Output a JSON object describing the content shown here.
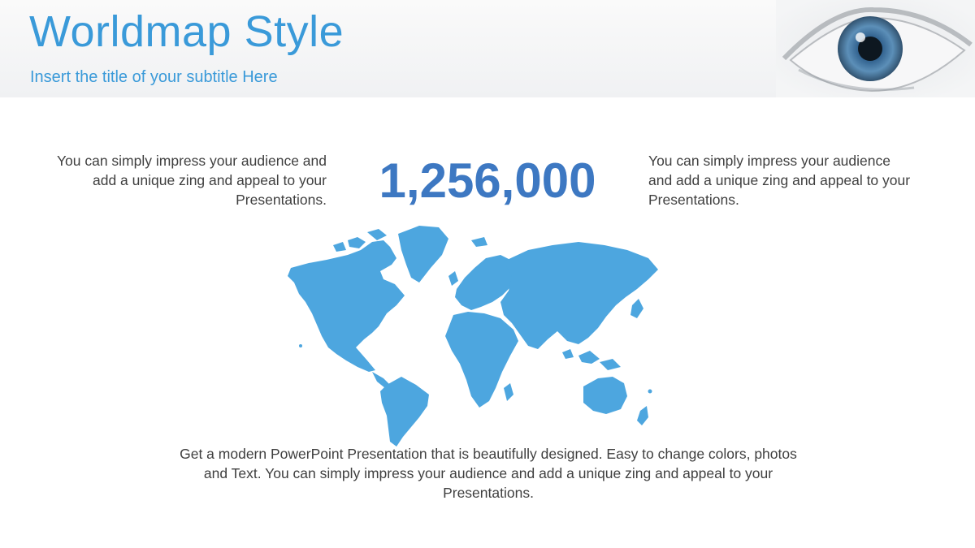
{
  "slide": {
    "title": "Worldmap Style",
    "subtitle": "Insert the title  of your subtitle Here"
  },
  "content": {
    "left_text": "You can simply impress your audience and add a unique zing and appeal to your Presentations.",
    "right_text": "You can simply impress your audience and add a unique zing and appeal to your Presentations.",
    "big_number": "1,256,000",
    "bottom_text": "Get a modern PowerPoint  Presentation that is beautifully designed.  Easy to change colors, photos and Text. You can simply impress your audience and add a unique zing and appeal to your Presentations."
  },
  "colors": {
    "title": "#3a9ad9",
    "big_number": "#3d78c2",
    "map": "#4da6df",
    "body_text": "#3f3f3f"
  },
  "icons": {
    "header_image": "eye-image",
    "map_image": "world-map"
  }
}
